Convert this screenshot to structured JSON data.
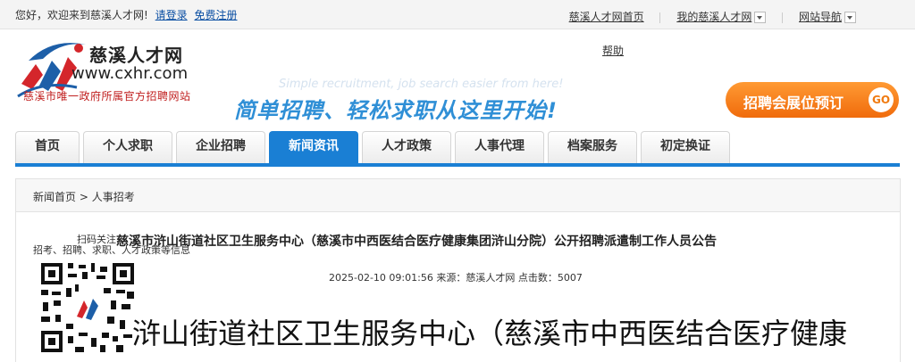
{
  "topbar": {
    "welcome": "您好，欢迎来到慈溪人才网!",
    "login": "请登录",
    "register": "免费注册",
    "links": [
      "慈溪人才网首页",
      "我的慈溪人才网",
      "网站导航"
    ]
  },
  "header": {
    "logo_cn": "慈溪人才网",
    "logo_url": "www.cxhr.com",
    "tagline": "慈溪市唯一政府所属官方招聘网站",
    "help": "帮助",
    "slogan_en": "Simple recruitment, job search easier from here!",
    "slogan_cn": "简单招聘、轻松求职从这里开始!",
    "booth_button": "招聘会展位预订",
    "go": "GO"
  },
  "nav": {
    "tabs": [
      "首页",
      "个人求职",
      "企业招聘",
      "新闻资讯",
      "人才政策",
      "人事代理",
      "档案服务",
      "初定换证"
    ],
    "active": "新闻资讯"
  },
  "breadcrumb": {
    "home": "新闻首页",
    "separator": ">",
    "current": "人事招考"
  },
  "article": {
    "scan_line1": "扫码关注",
    "scan_line2": "招考、招聘、求职、人才政策等信息",
    "title": "慈溪市浒山街道社区卫生服务中心（慈溪市中西医结合医疗健康集团浒山分院）公开招聘派遣制工作人员公告",
    "meta": "2025-02-10 09:01:56 来源：慈溪人才网 点击数：5007",
    "body_heading": "浒山街道社区卫生服务中心（慈溪市中西医结合医疗健康"
  },
  "colors": {
    "primary_blue": "#1a7fd4",
    "brand_red": "#c01e1e",
    "booth_orange": "#f07a10"
  }
}
